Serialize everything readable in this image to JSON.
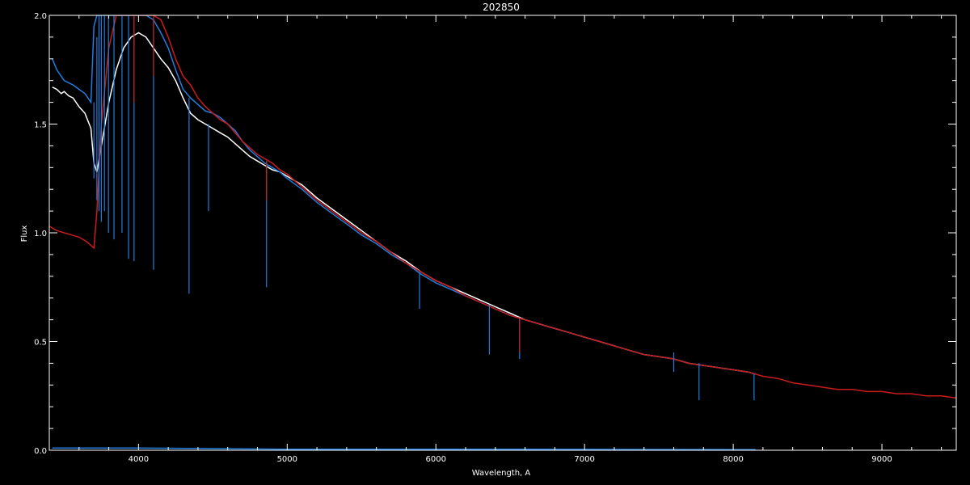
{
  "chart_data": {
    "type": "line",
    "title": "202850",
    "xlabel": "Wavelength, A",
    "ylabel": "Flux",
    "xlim": [
      3400,
      9500
    ],
    "ylim": [
      0.0,
      2.0
    ],
    "x_ticks": [
      4000,
      5000,
      6000,
      7000,
      8000,
      9000
    ],
    "x_tick_labels": [
      "4000",
      "5000",
      "6000",
      "7000",
      "8000",
      "9000"
    ],
    "y_ticks": [
      0.0,
      0.5,
      1.0,
      1.5,
      2.0
    ],
    "y_tick_labels": [
      "0.0",
      "0.5",
      "1.0",
      "1.5",
      "2.0"
    ],
    "grid": false,
    "background": "#000000",
    "series": [
      {
        "color": "#ffffff",
        "x": [
          3420,
          3450,
          3480,
          3500,
          3530,
          3560,
          3600,
          3640,
          3680,
          3700,
          3720,
          3750,
          3800,
          3850,
          3900,
          3950,
          4000,
          4050,
          4100,
          4150,
          4200,
          4250,
          4300,
          4350,
          4400,
          4450,
          4500,
          4550,
          4600,
          4650,
          4700,
          4750,
          4800,
          4850,
          4900,
          4950,
          5000,
          5100,
          5200,
          5300,
          5400,
          5500,
          5600,
          5700,
          5800,
          5900,
          6000,
          6100,
          6200,
          6300,
          6400,
          6500,
          6600,
          6700,
          6800,
          6900,
          7000,
          7100,
          7200,
          7300,
          7400,
          7500,
          7600,
          7700,
          7800,
          7900,
          8000,
          8100,
          8150
        ],
        "y": [
          1.67,
          1.66,
          1.64,
          1.65,
          1.63,
          1.62,
          1.58,
          1.55,
          1.48,
          1.32,
          1.28,
          1.4,
          1.6,
          1.75,
          1.85,
          1.9,
          1.92,
          1.9,
          1.85,
          1.8,
          1.76,
          1.7,
          1.62,
          1.55,
          1.52,
          1.5,
          1.48,
          1.46,
          1.44,
          1.41,
          1.38,
          1.35,
          1.33,
          1.31,
          1.29,
          1.28,
          1.26,
          1.22,
          1.16,
          1.11,
          1.06,
          1.01,
          0.96,
          0.91,
          0.87,
          0.82,
          0.78,
          0.75,
          0.72,
          0.69,
          0.66,
          0.63,
          0.6,
          0.58,
          0.56,
          0.54,
          0.52,
          0.5,
          0.48,
          0.46,
          0.44,
          0.43,
          0.42,
          0.4,
          0.39,
          0.38,
          0.37,
          0.36,
          0.35
        ]
      },
      {
        "color": "#1e7fe0",
        "x": [
          3420,
          3450,
          3480,
          3500,
          3530,
          3560,
          3600,
          3640,
          3680,
          3700,
          3720,
          3750,
          3800,
          3850,
          3900,
          3950,
          4000,
          4050,
          4100,
          4150,
          4200,
          4250,
          4300,
          4350,
          4400,
          4450,
          4500,
          4550,
          4600,
          4650,
          4700,
          4750,
          4800,
          4850,
          4900,
          4950,
          5000,
          5100,
          5200,
          5300,
          5400,
          5500,
          5600,
          5700,
          5800,
          5900,
          6000,
          6100,
          6200,
          6300,
          6400,
          6500,
          6600,
          6700,
          6800,
          6900,
          7000,
          7100,
          7200,
          7300,
          7400,
          7500,
          7600,
          7700,
          7800,
          7900,
          8000,
          8100,
          8150
        ],
        "y": [
          1.8,
          1.75,
          1.72,
          1.7,
          1.69,
          1.68,
          1.66,
          1.64,
          1.6,
          1.95,
          2.05,
          2.08,
          2.1,
          2.1,
          2.1,
          2.08,
          2.05,
          2.02,
          1.98,
          1.92,
          1.85,
          1.75,
          1.66,
          1.62,
          1.59,
          1.56,
          1.55,
          1.53,
          1.5,
          1.47,
          1.42,
          1.38,
          1.35,
          1.32,
          1.3,
          1.28,
          1.25,
          1.2,
          1.14,
          1.09,
          1.04,
          0.99,
          0.95,
          0.9,
          0.86,
          0.81,
          0.77,
          0.74,
          0.71,
          0.68,
          0.65,
          0.62,
          0.6,
          0.58,
          0.56,
          0.54,
          0.52,
          0.5,
          0.48,
          0.46,
          0.44,
          0.43,
          0.42,
          0.4,
          0.39,
          0.38,
          0.37,
          0.36,
          0.35
        ]
      },
      {
        "color": "#cc1a1a",
        "x": [
          3400,
          3450,
          3500,
          3550,
          3600,
          3650,
          3700,
          3720,
          3750,
          3800,
          3850,
          3900,
          3950,
          4000,
          4050,
          4100,
          4150,
          4200,
          4250,
          4300,
          4350,
          4400,
          4450,
          4500,
          4550,
          4600,
          4650,
          4700,
          4750,
          4800,
          4850,
          4900,
          4950,
          5000,
          5100,
          5200,
          5300,
          5400,
          5500,
          5600,
          5700,
          5800,
          5900,
          6000,
          6100,
          6200,
          6300,
          6400,
          6500,
          6600,
          6700,
          6800,
          6900,
          7000,
          7100,
          7200,
          7300,
          7400,
          7500,
          7600,
          7700,
          7800,
          7900,
          8000,
          8100,
          8200,
          8300,
          8400,
          8500,
          8600,
          8700,
          8800,
          8900,
          9000,
          9100,
          9200,
          9300,
          9400,
          9500
        ],
        "y": [
          1.03,
          1.01,
          1.0,
          0.99,
          0.98,
          0.96,
          0.93,
          1.1,
          1.5,
          1.85,
          2.05,
          2.15,
          2.15,
          2.12,
          2.08,
          2.04,
          1.98,
          1.9,
          1.8,
          1.72,
          1.68,
          1.62,
          1.58,
          1.55,
          1.52,
          1.5,
          1.46,
          1.42,
          1.39,
          1.36,
          1.34,
          1.32,
          1.29,
          1.27,
          1.21,
          1.15,
          1.1,
          1.05,
          1.0,
          0.96,
          0.91,
          0.86,
          0.82,
          0.78,
          0.75,
          0.71,
          0.68,
          0.65,
          0.62,
          0.6,
          0.58,
          0.56,
          0.54,
          0.52,
          0.5,
          0.48,
          0.46,
          0.44,
          0.43,
          0.42,
          0.4,
          0.39,
          0.38,
          0.37,
          0.36,
          0.34,
          0.33,
          0.31,
          0.3,
          0.29,
          0.28,
          0.28,
          0.27,
          0.27,
          0.26,
          0.26,
          0.25,
          0.25,
          0.24
        ]
      },
      {
        "color": "#1e7fe0",
        "x": [
          3420,
          4000,
          5000,
          6000,
          7000,
          8000,
          8150
        ],
        "y": [
          0.01,
          0.01,
          0.005,
          0.005,
          0.004,
          0.003,
          0.003
        ]
      }
    ],
    "absorption_lines": [
      {
        "x": 3700,
        "y_from": 1.6,
        "y_to": 1.25,
        "color": "#1e7fe0"
      },
      {
        "x": 3720,
        "y_from": 1.9,
        "y_to": 1.15,
        "color": "#1e7fe0"
      },
      {
        "x": 3734,
        "y_from": 2.0,
        "y_to": 1.1,
        "color": "#1e7fe0"
      },
      {
        "x": 3750,
        "y_from": 2.0,
        "y_to": 1.05,
        "color": "#1e7fe0"
      },
      {
        "x": 3771,
        "y_from": 2.0,
        "y_to": 1.1,
        "color": "#1e7fe0"
      },
      {
        "x": 3798,
        "y_from": 2.0,
        "y_to": 1.0,
        "color": "#1e7fe0"
      },
      {
        "x": 3835,
        "y_from": 2.0,
        "y_to": 0.97,
        "color": "#1e7fe0"
      },
      {
        "x": 3889,
        "y_from": 2.0,
        "y_to": 1.0,
        "color": "#1e7fe0"
      },
      {
        "x": 3933,
        "y_from": 2.0,
        "y_to": 0.88,
        "color": "#1e7fe0"
      },
      {
        "x": 3970,
        "y_from": 2.0,
        "y_to": 0.87,
        "color": "#1e7fe0"
      },
      {
        "x": 4101,
        "y_from": 1.98,
        "y_to": 0.83,
        "color": "#1e7fe0"
      },
      {
        "x": 4340,
        "y_from": 1.62,
        "y_to": 0.72,
        "color": "#1e7fe0"
      },
      {
        "x": 4471,
        "y_from": 1.5,
        "y_to": 1.1,
        "color": "#1e7fe0"
      },
      {
        "x": 4861,
        "y_from": 1.33,
        "y_to": 0.75,
        "color": "#1e7fe0"
      },
      {
        "x": 5890,
        "y_from": 0.82,
        "y_to": 0.65,
        "color": "#1e7fe0"
      },
      {
        "x": 6360,
        "y_from": 0.67,
        "y_to": 0.44,
        "color": "#1e7fe0"
      },
      {
        "x": 6563,
        "y_from": 0.61,
        "y_to": 0.42,
        "color": "#1e7fe0"
      },
      {
        "x": 7600,
        "y_from": 0.45,
        "y_to": 0.36,
        "color": "#1e7fe0"
      },
      {
        "x": 7770,
        "y_from": 0.4,
        "y_to": 0.23,
        "color": "#1e7fe0"
      },
      {
        "x": 8140,
        "y_from": 0.35,
        "y_to": 0.23,
        "color": "#1e7fe0"
      },
      {
        "x": 4861,
        "y_from": 1.33,
        "y_to": 1.15,
        "color": "#cc1a1a"
      },
      {
        "x": 6563,
        "y_from": 0.61,
        "y_to": 0.45,
        "color": "#cc1a1a"
      },
      {
        "x": 3970,
        "y_from": 2.0,
        "y_to": 1.6,
        "color": "#cc1a1a"
      },
      {
        "x": 4101,
        "y_from": 2.0,
        "y_to": 1.72,
        "color": "#cc1a1a"
      }
    ]
  }
}
